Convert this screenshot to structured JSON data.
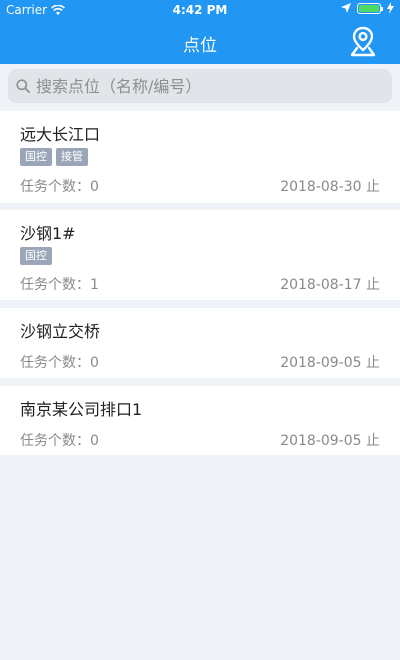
{
  "status_bar": {
    "carrier": "Carrier",
    "time": "4:42 PM"
  },
  "nav": {
    "title": "点位"
  },
  "search": {
    "placeholder": "搜索点位（名称/编号）"
  },
  "points": [
    {
      "name": "远大长江口",
      "tags": [
        "国控",
        "接管"
      ],
      "count_label": "任务个数：0",
      "date": "2018-08-30 止"
    },
    {
      "name": "沙钢1#",
      "tags": [
        "国控"
      ],
      "count_label": "任务个数：1",
      "date": "2018-08-17 止"
    },
    {
      "name": "沙钢立交桥",
      "tags": [],
      "count_label": "任务个数：0",
      "date": "2018-09-05 止"
    },
    {
      "name": "南京某公司排口1",
      "tags": [],
      "count_label": "任务个数：0",
      "date": "2018-09-05 止"
    }
  ],
  "colors": {
    "primary": "#2196f3",
    "background": "#eff2f6",
    "tag": "#9aa6b8"
  }
}
